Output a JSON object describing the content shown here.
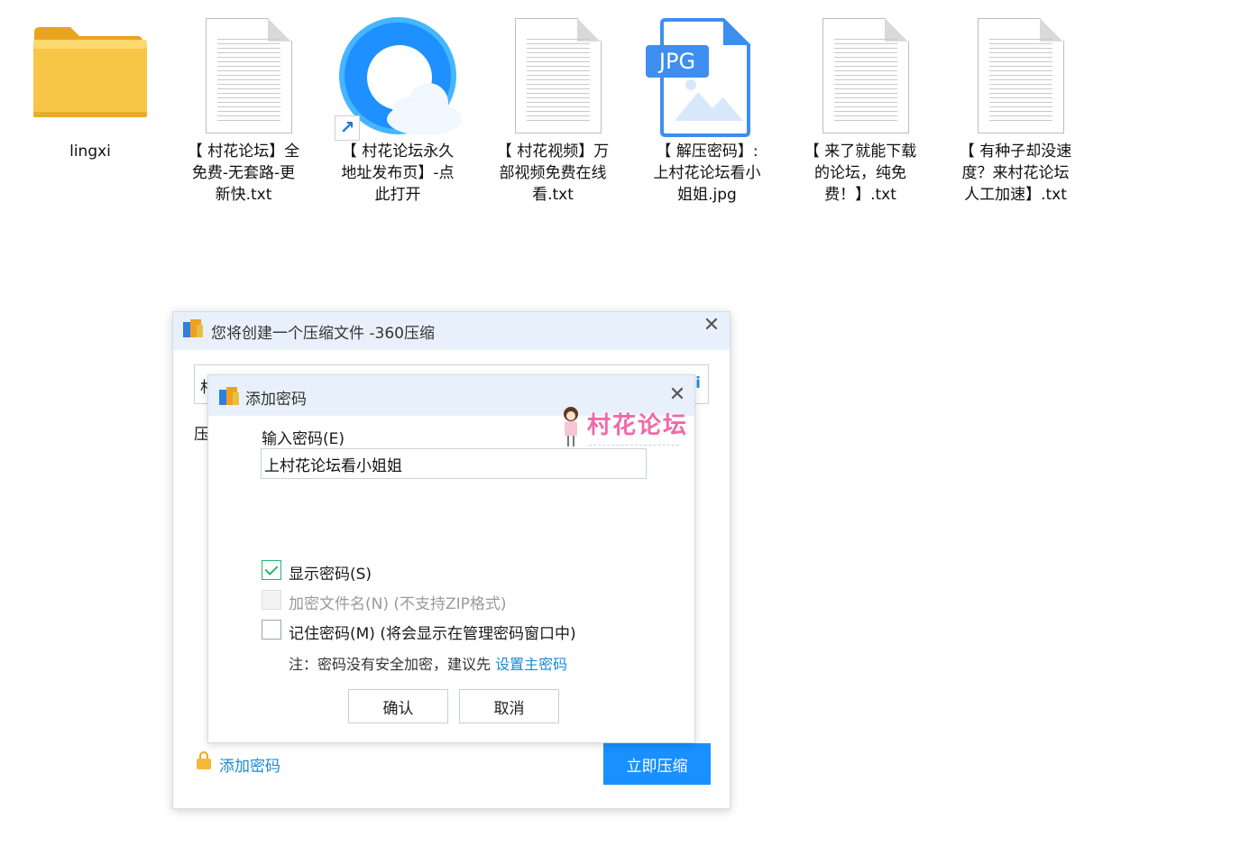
{
  "desktop": {
    "items": [
      {
        "type": "folder",
        "icon": "folder-icon",
        "label": "lingxi"
      },
      {
        "type": "txt",
        "icon": "text-file-icon",
        "label": "【 村花论坛】全\n免费-无套路-更\n新快.txt"
      },
      {
        "type": "shortcut",
        "icon": "browser-shortcut-icon",
        "label": "【 村花论坛永久\n地址发布页】-点\n此打开"
      },
      {
        "type": "txt",
        "icon": "text-file-icon",
        "label": "【 村花视频】万\n部视频免费在线\n看.txt"
      },
      {
        "type": "jpg",
        "icon": "jpg-file-icon",
        "badge": "JPG",
        "label": "【 解压密码】:\n上村花论坛看小\n姐姐.jpg"
      },
      {
        "type": "txt",
        "icon": "text-file-icon",
        "label": "【 来了就能下载\n的论坛，纯免\n费！】.txt"
      },
      {
        "type": "txt",
        "icon": "text-file-icon",
        "label": "【 有种子却没速\n度？来村花论坛\n人工加速】.txt"
      }
    ]
  },
  "compress_dialog": {
    "title": "您将创建一个压缩文件 -360压缩",
    "close_icon": "close-icon",
    "path_value_partial": "村",
    "path_side_char": "i",
    "options_label_partial": "压",
    "add_password_link": "添加密码",
    "compress_button": "立即压缩"
  },
  "password_dialog": {
    "title": "添加密码",
    "close_icon": "close-icon",
    "watermark": "村花论坛",
    "input_label": "输入密码(E)",
    "input_value": "上村花论坛看小姐姐",
    "options": [
      {
        "label": "显示密码(S)",
        "checked": true,
        "disabled": false
      },
      {
        "label": "加密文件名(N) (不支持ZIP格式)",
        "checked": false,
        "disabled": true
      },
      {
        "label": "记住密码(M) (将会显示在管理密码窗口中)",
        "checked": false,
        "disabled": false
      }
    ],
    "note_text": "注：密码没有安全加密，建议先 ",
    "note_link": "设置主密码",
    "ok_button": "确认",
    "cancel_button": "取消"
  },
  "colors": {
    "accent": "#1890ff",
    "link": "#1a8ad4",
    "titlebar": "#e8f1fb",
    "checkbox_checked": "#26b36f",
    "watermark": "#f06aa7"
  }
}
